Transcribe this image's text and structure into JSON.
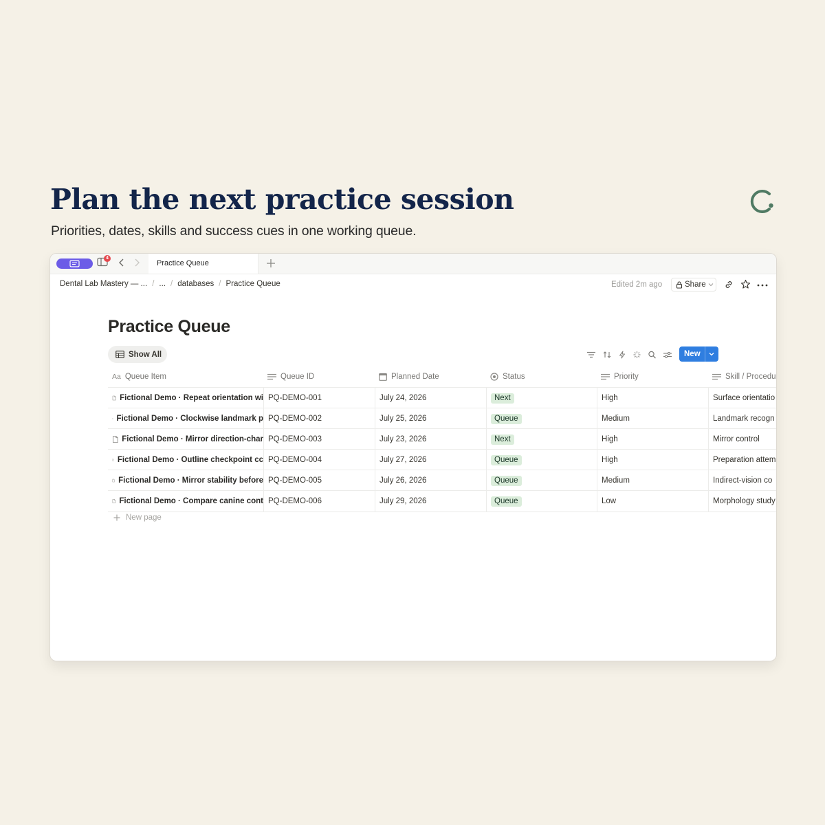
{
  "hero": {
    "headline": "Plan the next practice session",
    "subline": "Priorities, dates, skills and success cues in one working queue."
  },
  "tabbar": {
    "badge_count": "4",
    "active_tab": "Practice Queue",
    "new_tab_icon": "plus-icon"
  },
  "topbar": {
    "breadcrumb": [
      "Dental Lab Mastery — ...",
      "...",
      "databases",
      "Practice Queue"
    ],
    "edited": "Edited 2m ago",
    "share_label": "Share"
  },
  "page": {
    "title": "Practice Queue",
    "view_label": "Show All",
    "new_label": "New"
  },
  "table": {
    "columns": [
      "Queue Item",
      "Queue ID",
      "Planned Date",
      "Status",
      "Priority",
      "Skill / Procedu"
    ],
    "column_icons": [
      "text-aa-icon",
      "lines-icon",
      "calendar-icon",
      "status-circle-icon",
      "lines-icon",
      "lines-icon"
    ],
    "rows": [
      [
        "Fictional Demo · Repeat orientation wi",
        "PQ-DEMO-001",
        "July 24, 2026",
        "Next",
        "High",
        "Surface orientatio"
      ],
      [
        "Fictional Demo · Clockwise landmark p",
        "PQ-DEMO-002",
        "July 25, 2026",
        "Queue",
        "Medium",
        "Landmark recogn"
      ],
      [
        "Fictional Demo · Mirror direction-char",
        "PQ-DEMO-003",
        "July 23, 2026",
        "Next",
        "High",
        "Mirror control"
      ],
      [
        "Fictional Demo · Outline checkpoint cc",
        "PQ-DEMO-004",
        "July 27, 2026",
        "Queue",
        "High",
        "Preparation attem"
      ],
      [
        "Fictional Demo · Mirror stability before",
        "PQ-DEMO-005",
        "July 26, 2026",
        "Queue",
        "Medium",
        "Indirect-vision co"
      ],
      [
        "Fictional Demo · Compare canine cont",
        "PQ-DEMO-006",
        "July 29, 2026",
        "Queue",
        "Low",
        "Morphology study"
      ]
    ],
    "new_page_label": "New page"
  },
  "colors": {
    "background": "#f5f1e7",
    "headline": "#13254a",
    "brand_mark": "#4f7a63",
    "home_pill": "#6c5ce7",
    "primary_button": "#2f7ee0",
    "status_tag_bg": "#dbeddb"
  }
}
